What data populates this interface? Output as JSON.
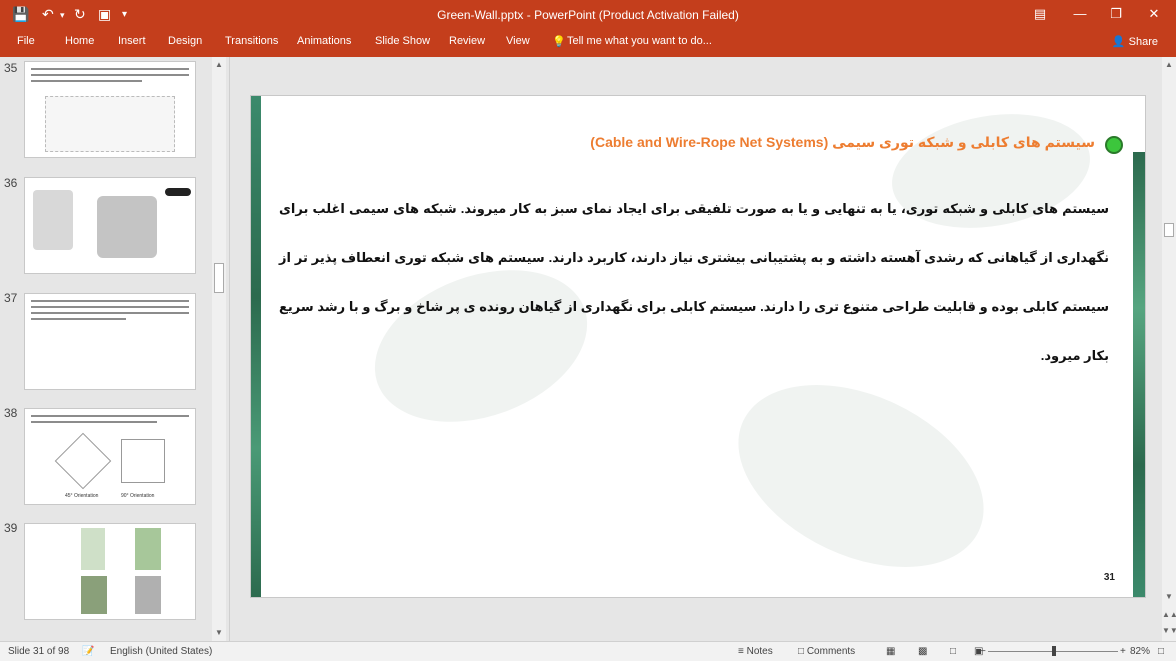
{
  "window": {
    "title": "Green-Wall.pptx - PowerPoint (Product Activation Failed)",
    "quick_access": [
      "save-icon",
      "undo-icon",
      "redo-icon",
      "slideshow-icon",
      "customize-icon"
    ]
  },
  "ribbon": {
    "tabs": [
      "File",
      "Home",
      "Insert",
      "Design",
      "Transitions",
      "Animations",
      "Slide Show",
      "Review",
      "View"
    ],
    "tell_me": "Tell me what you want to do...",
    "share": "Share"
  },
  "thumbnails": [
    {
      "num": "35"
    },
    {
      "num": "36"
    },
    {
      "num": "37"
    },
    {
      "num": "38",
      "labels": [
        "45° Orientation",
        "90° Orientation"
      ]
    },
    {
      "num": "39"
    }
  ],
  "slide": {
    "heading": "سیستم های کابلی و شبکه توری سیمی (Cable and Wire-Rope Net Systems)",
    "body": "سیستم های کابلی و شبکه توری، یا به تنهایی و یا به صورت تلفیقی برای ایجاد نمای سبز به کار میروند. شبکه های سیمی اغلب برای نگهداری از گیاهانی که رشدی آهسته داشته و به پشتیبانی بیشتری نیاز دارند، کاربرد دارند. سیستم های شبکه توری انعطاف پذیر تر از سیستم کابلی بوده و قابلیت طراحی متنوع تری را دارند. سیستم کابلی برای نگهداری از گیاهان رونده ی پر شاخ و برگ و با رشد سریع بکار میرود.",
    "number": "31"
  },
  "status": {
    "slide_info": "Slide 31 of 98",
    "language": "English (United States)",
    "notes": "Notes",
    "comments": "Comments",
    "zoom": "82%"
  },
  "colors": {
    "accent": "#c43e1c",
    "heading": "#ed7d31",
    "bullet": "#3cc63c"
  }
}
